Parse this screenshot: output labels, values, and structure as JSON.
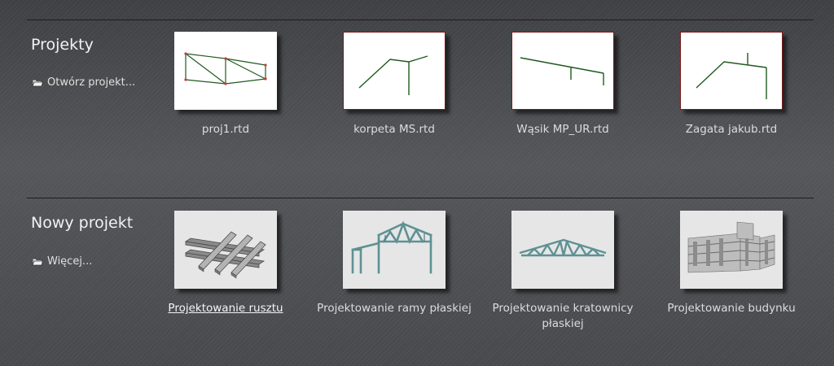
{
  "projects": {
    "title": "Projekty",
    "open_label": "Otwórz projekt...",
    "recent": [
      {
        "label": "proj1.rtd",
        "icon": "truss-frame-preview"
      },
      {
        "label": "korpeta MS.rtd",
        "icon": "frame-preview"
      },
      {
        "label": "Wąsik MP_UR.rtd",
        "icon": "beam-preview"
      },
      {
        "label": "Zagata jakub.rtd",
        "icon": "frame-preview"
      }
    ]
  },
  "new_project": {
    "title": "Nowy projekt",
    "more_label": "Więcej...",
    "templates": [
      {
        "label": "Projektowanie rusztu",
        "icon": "grillage-icon"
      },
      {
        "label": "Projektowanie ramy płaskiej",
        "icon": "plane-frame-icon"
      },
      {
        "label": "Projektowanie kratownicy płaskiej",
        "icon": "plane-truss-icon"
      },
      {
        "label": "Projektowanie budynku",
        "icon": "building-icon"
      }
    ]
  },
  "colors": {
    "background": "#4a4b4e",
    "structure_line": "#1e5a1e",
    "template_steel": "#6f9ea0",
    "thumb_border": "#7a1a1a"
  }
}
